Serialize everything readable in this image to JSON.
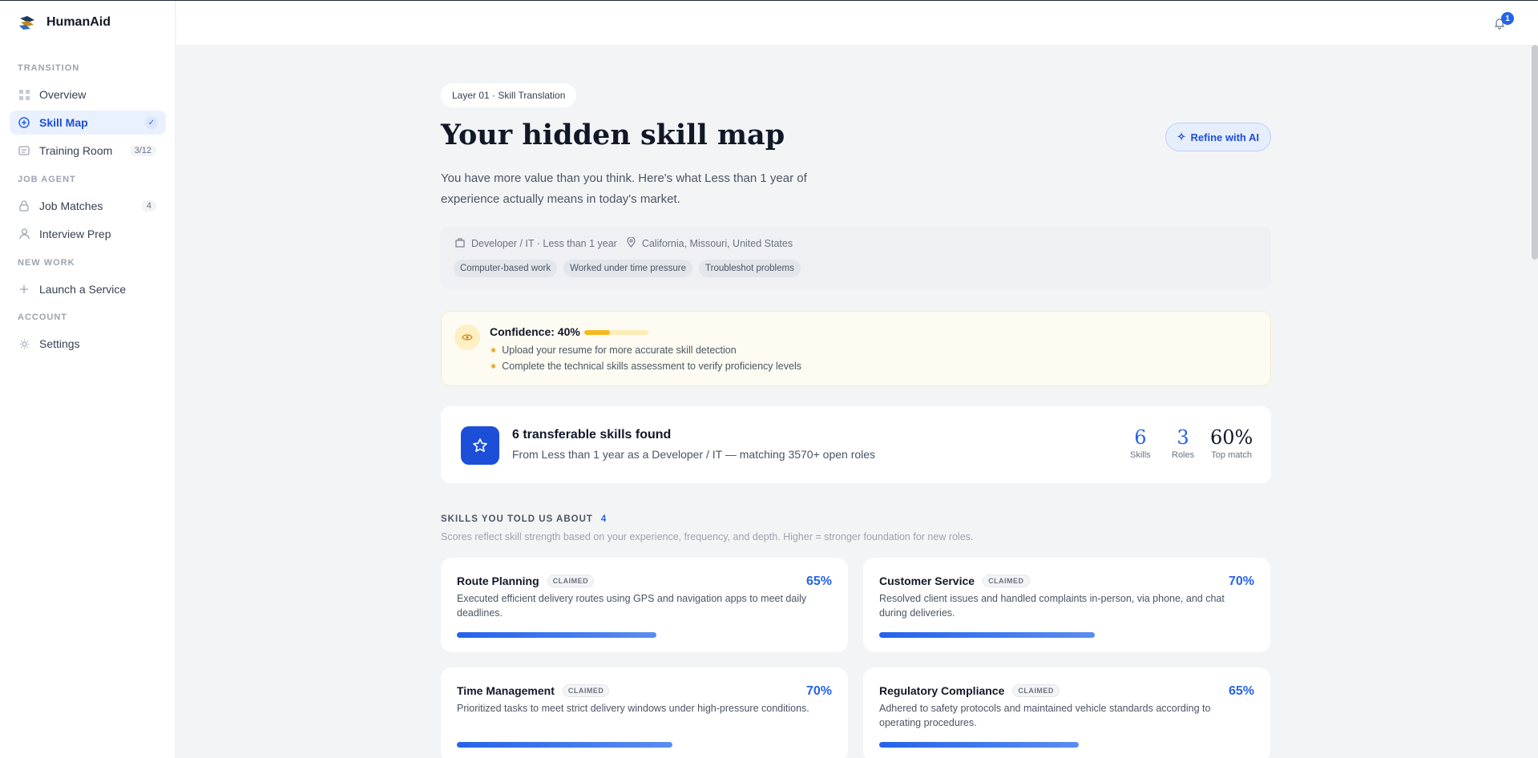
{
  "app": {
    "name": "HumanAid"
  },
  "sidebar": {
    "sections": [
      {
        "label": "TRANSITION"
      },
      {
        "label": "JOB AGENT"
      },
      {
        "label": "NEW WORK"
      },
      {
        "label": "ACCOUNT"
      }
    ],
    "items": [
      {
        "label": "Overview",
        "icon": "grid-icon"
      },
      {
        "label": "Skill Map",
        "icon": "target-icon",
        "active": true
      },
      {
        "label": "Training Room",
        "icon": "card-icon",
        "badge": "3/12"
      },
      {
        "label": "Job Matches",
        "icon": "lock-icon",
        "badge": "4"
      },
      {
        "label": "Interview Prep",
        "icon": "user-icon"
      },
      {
        "label": "Launch a Service",
        "icon": "plus-icon"
      },
      {
        "label": "Settings",
        "icon": "sun-icon"
      }
    ]
  },
  "topbar": {
    "notifications": "1"
  },
  "page": {
    "pill": "Layer 01 · Skill Translation",
    "title": "Your hidden skill map",
    "refine_label": "Refine with AI",
    "subtitle": "You have more value than you think. Here's what Less than 1 year of experience actually means in today's market."
  },
  "context": {
    "role": "Developer / IT · Less than 1 year",
    "location": "California, Missouri, United States",
    "tags": [
      "Computer-based work",
      "Worked under time pressure",
      "Troubleshot problems"
    ]
  },
  "confidence": {
    "title": "Confidence: 40%",
    "level": 0.4,
    "tips": [
      "Upload your resume for more accurate skill detection",
      "Complete the technical skills assessment to verify proficiency levels"
    ]
  },
  "summary": {
    "title": "6 transferable skills found",
    "subtitle": "From Less than 1 year as a Developer / IT — matching 3570+ open roles",
    "stats": [
      {
        "value": "6",
        "label": "Skills"
      },
      {
        "value": "3",
        "label": "Roles"
      },
      {
        "value": "60%",
        "label": "Top match"
      }
    ]
  },
  "skills": {
    "heading": "SKILLS YOU TOLD US ABOUT",
    "count": "4",
    "note": "Scores reflect skill strength based on your experience, frequency, and depth. Higher = stronger foundation for new roles.",
    "badge": "CLAIMED",
    "items": [
      {
        "name": "Route Planning",
        "pct": "65%",
        "level": 0.65,
        "desc": "Executed efficient delivery routes using GPS and navigation apps to meet daily deadlines."
      },
      {
        "name": "Customer Service",
        "pct": "70%",
        "level": 0.7,
        "desc": "Resolved client issues and handled complaints in-person, via phone, and chat during deliveries."
      },
      {
        "name": "Time Management",
        "pct": "70%",
        "level": 0.7,
        "desc": "Prioritized tasks to meet strict delivery windows under high-pressure conditions."
      },
      {
        "name": "Regulatory Compliance",
        "pct": "65%",
        "level": 0.65,
        "desc": "Adhered to safety protocols and maintained vehicle standards according to operating procedures."
      }
    ]
  },
  "colors": {
    "accent": "#2563eb",
    "warning": "#f5b920"
  }
}
